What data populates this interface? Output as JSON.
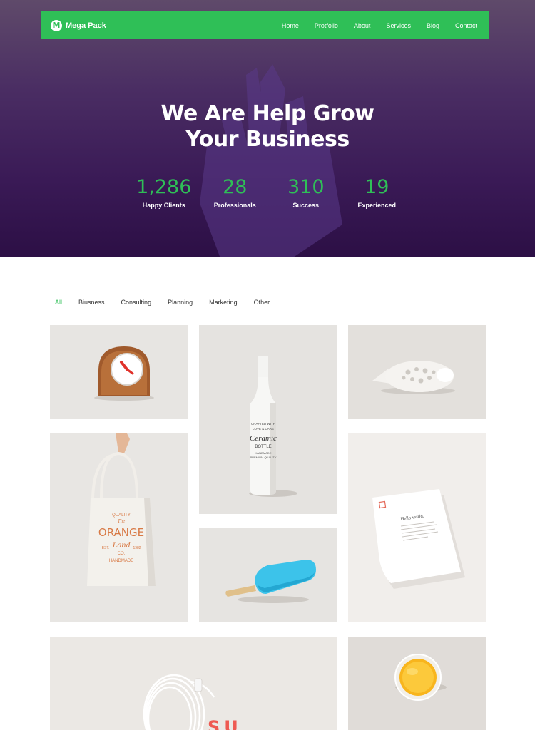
{
  "brand": {
    "name": "Mega Pack",
    "logo_letter": "M"
  },
  "nav": {
    "items": [
      "Home",
      "Protfolio",
      "About",
      "Services",
      "Blog",
      "Contact"
    ]
  },
  "hero": {
    "title_line1": "We Are Help Grow",
    "title_line2": "Your Business",
    "stats": [
      {
        "value": "1,286",
        "label": "Happy Clients"
      },
      {
        "value": "28",
        "label": "Professionals"
      },
      {
        "value": "310",
        "label": "Success"
      },
      {
        "value": "19",
        "label": "Experienced"
      }
    ]
  },
  "portfolio": {
    "filters": [
      "All",
      "Biusness",
      "Consulting",
      "Planning",
      "Marketing",
      "Other"
    ],
    "active_filter": "All",
    "items": [
      {
        "name": "clock",
        "image": "wooden-clock-image"
      },
      {
        "name": "bottle",
        "image": "ceramic-bottle-image",
        "bottle_text": [
          "CRAFTED WITH",
          "LOVE & CARE",
          "Ceramic",
          "BOTTLE",
          "HANDMADE",
          "PREMIUM QUALITY"
        ]
      },
      {
        "name": "fish",
        "image": "ceramic-fish-image"
      },
      {
        "name": "tote",
        "image": "tote-bag-image",
        "bag_text": [
          "QUALITY",
          "The",
          "ORANGE",
          "Land",
          "CO.",
          "EST.",
          "1982",
          "HANDMADE"
        ]
      },
      {
        "name": "letter",
        "image": "letterhead-image",
        "letter_text": "Hello world."
      },
      {
        "name": "popsicle",
        "image": "popsicle-image"
      },
      {
        "name": "earphones",
        "image": "earphones-image",
        "tile_text": "SU"
      },
      {
        "name": "juice",
        "image": "juice-glass-image"
      }
    ]
  },
  "colors": {
    "accent": "#2fbf57",
    "hero_dark": "#2c0f45",
    "tile_bg": "#e9e7e4"
  }
}
